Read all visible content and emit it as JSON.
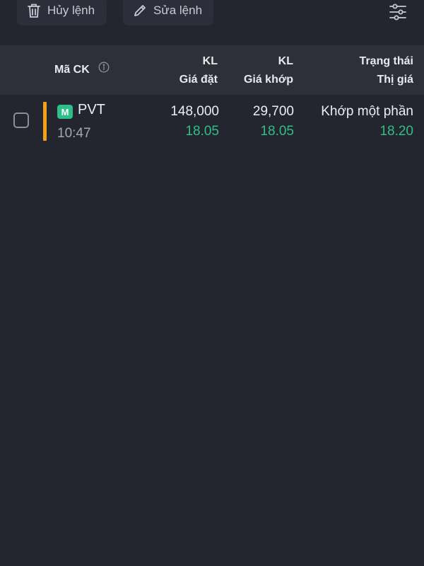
{
  "toolbar": {
    "cancel_label": "Hủy lệnh",
    "edit_label": "Sửa lệnh",
    "cancel_icon": "trash-icon",
    "edit_icon": "pencil-icon",
    "filter_icon": "sliders-icon"
  },
  "table": {
    "headers": {
      "code": "Mã CK",
      "order_qty": "KL",
      "order_price": "Giá đặt",
      "match_qty": "KL",
      "match_price": "Giá khớp",
      "status": "Trạng thái",
      "market_price": "Thị giá"
    },
    "rows": [
      {
        "badge": "M",
        "symbol": "PVT",
        "time": "10:47",
        "order_qty": "148,000",
        "order_price": "18.05",
        "match_qty": "29,700",
        "match_price": "18.05",
        "status": "Khớp một phần",
        "market_price": "18.20"
      }
    ]
  },
  "colors": {
    "background": "#23252f",
    "header_bg": "#2d3039",
    "accent_green": "#2fbf86",
    "side_marker": "#f0a21b"
  }
}
